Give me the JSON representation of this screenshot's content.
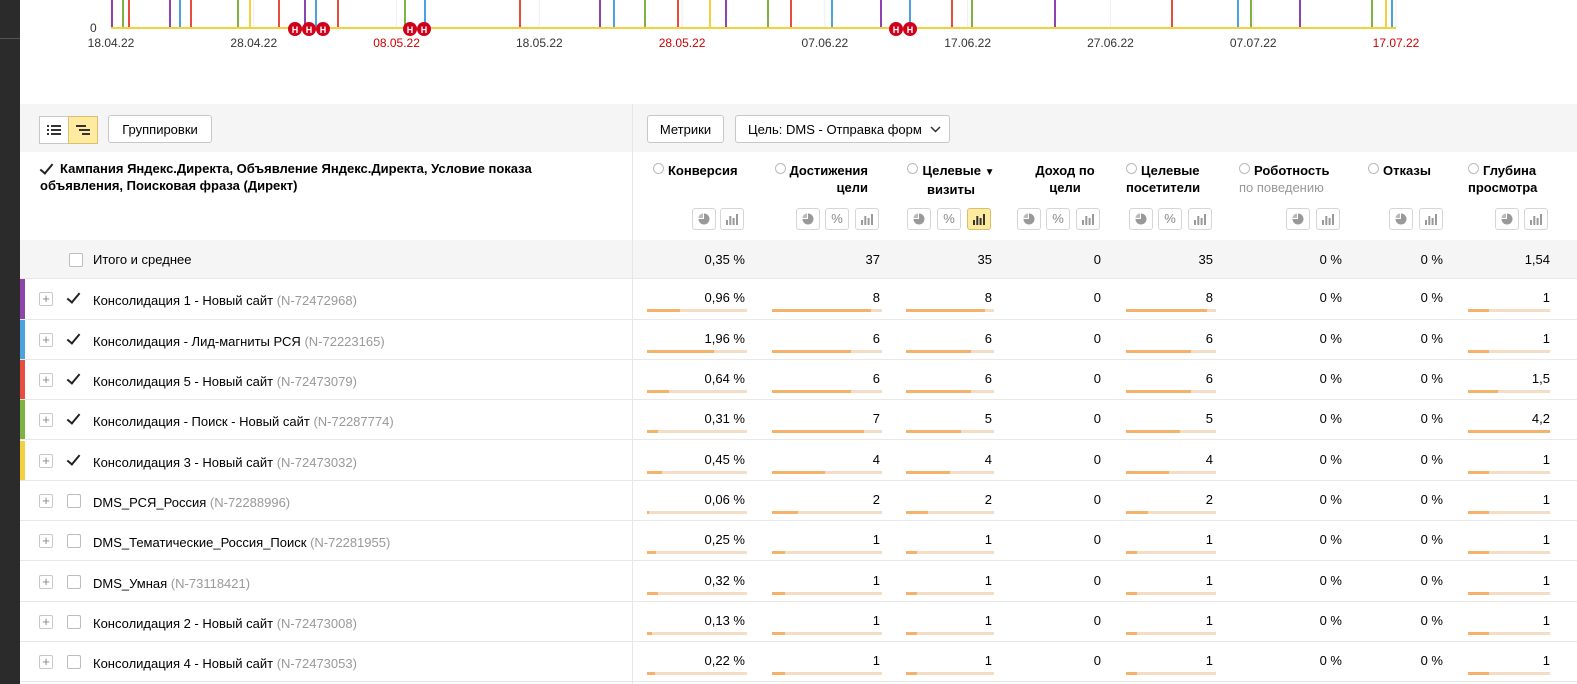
{
  "chart": {
    "y_zero_label": "0",
    "x_ticks": [
      {
        "label": "18.04.22",
        "weekend": false
      },
      {
        "label": "28.04.22",
        "weekend": false
      },
      {
        "label": "08.05.22",
        "weekend": true
      },
      {
        "label": "18.05.22",
        "weekend": false
      },
      {
        "label": "28.05.22",
        "weekend": true
      },
      {
        "label": "07.06.22",
        "weekend": false
      },
      {
        "label": "17.06.22",
        "weekend": false
      },
      {
        "label": "27.06.22",
        "weekend": false
      },
      {
        "label": "07.07.22",
        "weekend": false
      },
      {
        "label": "17.07.22",
        "weekend": true
      }
    ],
    "holiday_marker_label": "Н",
    "colors": {
      "purple": "#8e44ad",
      "blue": "#4aa3df",
      "red": "#e74c3c",
      "green": "#7cb342",
      "yellow": "#f4d03f",
      "weekend": "#cc0000",
      "marker": "#d0021b"
    }
  },
  "toolbar": {
    "grouping_label": "Группировки",
    "metrics_label": "Метрики",
    "goal_label": "Цель: DMS - Отправка форм"
  },
  "table": {
    "dimension_header": "Кампания Яндекс.Директа, Объявление Яндекс.Директа, Условие показа объявления, Поисковая фраза (Директ)",
    "columns": [
      {
        "line1": "Конверсия",
        "line2": "",
        "sub": ""
      },
      {
        "line1": "Достижения",
        "line2": "цели",
        "sub": ""
      },
      {
        "line1": "Целевые",
        "line2": "визиты",
        "sub": "",
        "sort": "▼"
      },
      {
        "line1": "Доход по",
        "line2": "цели",
        "sub": ""
      },
      {
        "line1": "Целевые",
        "line2": "посетители",
        "sub": ""
      },
      {
        "line1": "Роботность",
        "line2": "",
        "sub": "по поведению"
      },
      {
        "line1": "Отказы",
        "line2": "",
        "sub": ""
      },
      {
        "line1": "Глубина",
        "line2": "просмотра",
        "sub": ""
      }
    ],
    "total": {
      "label": "Итого и среднее",
      "values": [
        "0,35 %",
        "37",
        "35",
        "0",
        "35",
        "0 %",
        "0 %",
        "1,54"
      ]
    },
    "rows": [
      {
        "name": "Консолидация 1 - Новый сайт",
        "id": "(N-72472968)",
        "checked": true,
        "color": "#8e44ad",
        "values": [
          "0,96 %",
          "8",
          "8",
          "0",
          "8",
          "0 %",
          "0 %",
          "1"
        ],
        "bars": [
          0.33,
          0.9,
          0.9,
          0,
          0.9,
          0,
          0,
          0.25
        ]
      },
      {
        "name": "Консолидация - Лид-магниты РСЯ",
        "id": "(N-72223165)",
        "checked": true,
        "color": "#4aa3df",
        "values": [
          "1,96 %",
          "6",
          "6",
          "0",
          "6",
          "0 %",
          "0 %",
          "1"
        ],
        "bars": [
          0.67,
          0.72,
          0.74,
          0,
          0.72,
          0,
          0,
          0.25
        ]
      },
      {
        "name": "Консолидация 5 - Новый сайт",
        "id": "(N-72473079)",
        "checked": true,
        "color": "#e74c3c",
        "values": [
          "0,64 %",
          "6",
          "6",
          "0",
          "6",
          "0 %",
          "0 %",
          "1,5"
        ],
        "bars": [
          0.22,
          0.72,
          0.74,
          0,
          0.72,
          0,
          0,
          0.36
        ]
      },
      {
        "name": "Консолидация - Поиск - Новый сайт",
        "id": "(N-72287774)",
        "checked": true,
        "color": "#7cb342",
        "values": [
          "0,31 %",
          "7",
          "5",
          "0",
          "5",
          "0 %",
          "0 %",
          "4,2"
        ],
        "bars": [
          0.11,
          0.84,
          0.62,
          0,
          0.6,
          0,
          0,
          1
        ]
      },
      {
        "name": "Консолидация 3 - Новый сайт",
        "id": "(N-72473032)",
        "checked": true,
        "color": "#f4d03f",
        "values": [
          "0,45 %",
          "4",
          "4",
          "0",
          "4",
          "0 %",
          "0 %",
          "1"
        ],
        "bars": [
          0.15,
          0.48,
          0.5,
          0,
          0.48,
          0,
          0,
          0.25
        ]
      },
      {
        "name": "DMS_РСЯ_Россия",
        "id": "(N-72288996)",
        "checked": false,
        "color": "",
        "values": [
          "0,06 %",
          "2",
          "2",
          "0",
          "2",
          "0 %",
          "0 %",
          "1"
        ],
        "bars": [
          0.02,
          0.24,
          0.25,
          0,
          0.24,
          0,
          0,
          0.25
        ]
      },
      {
        "name": "DMS_Тематические_Россия_Поиск",
        "id": "(N-72281955)",
        "checked": false,
        "color": "",
        "values": [
          "0,25 %",
          "1",
          "1",
          "0",
          "1",
          "0 %",
          "0 %",
          "1"
        ],
        "bars": [
          0.09,
          0.12,
          0.12,
          0,
          0.12,
          0,
          0,
          0.25
        ]
      },
      {
        "name": "DMS_Умная",
        "id": "(N-73118421)",
        "checked": false,
        "color": "",
        "values": [
          "0,32 %",
          "1",
          "1",
          "0",
          "1",
          "0 %",
          "0 %",
          "1"
        ],
        "bars": [
          0.11,
          0.12,
          0.12,
          0,
          0.12,
          0,
          0,
          0.25
        ]
      },
      {
        "name": "Консолидация 2 - Новый сайт",
        "id": "(N-72473008)",
        "checked": false,
        "color": "",
        "values": [
          "0,13 %",
          "1",
          "1",
          "0",
          "1",
          "0 %",
          "0 %",
          "1"
        ],
        "bars": [
          0.05,
          0.12,
          0.12,
          0,
          0.12,
          0,
          0,
          0.25
        ]
      },
      {
        "name": "Консолидация 4 - Новый сайт",
        "id": "(N-72473053)",
        "checked": false,
        "color": "",
        "values": [
          "0,22 %",
          "1",
          "1",
          "0",
          "1",
          "0 %",
          "0 %",
          "1"
        ],
        "bars": [
          0.08,
          0.12,
          0.12,
          0,
          0.12,
          0,
          0,
          0.25
        ]
      }
    ]
  }
}
